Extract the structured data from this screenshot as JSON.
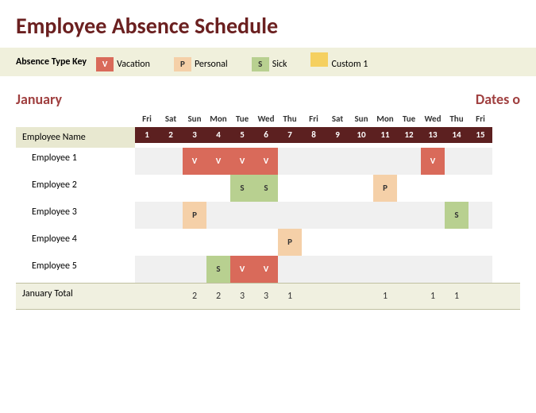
{
  "title": "Employee Absence Schedule",
  "legend": {
    "label": "Absence Type Key",
    "items": [
      {
        "code": "V",
        "text": "Vacation",
        "cls": "v-cell"
      },
      {
        "code": "P",
        "text": "Personal",
        "cls": "p-cell"
      },
      {
        "code": "S",
        "text": "Sick",
        "cls": "s-cell"
      },
      {
        "code": "",
        "text": "Custom 1",
        "cls": "c1-cell"
      }
    ]
  },
  "month": "January",
  "dates_label": "Dates o",
  "day_names": [
    "Fri",
    "Sat",
    "Sun",
    "Mon",
    "Tue",
    "Wed",
    "Thu",
    "Fri",
    "Sat",
    "Sun",
    "Mon",
    "Tue",
    "Wed",
    "Thu",
    "Fri"
  ],
  "dates": [
    "1",
    "2",
    "3",
    "4",
    "5",
    "6",
    "7",
    "8",
    "9",
    "10",
    "11",
    "12",
    "13",
    "14",
    "15"
  ],
  "emp_header": "Employee Name",
  "employees": [
    {
      "name": "Employee 1",
      "abs": [
        "",
        "",
        "V",
        "V",
        "V",
        "V",
        "",
        "",
        "",
        "",
        "",
        "",
        "V",
        "",
        ""
      ]
    },
    {
      "name": "Employee 2",
      "abs": [
        "",
        "",
        "",
        "",
        "S",
        "S",
        "",
        "",
        "",
        "",
        "P",
        "",
        "",
        "",
        ""
      ]
    },
    {
      "name": "Employee 3",
      "abs": [
        "",
        "",
        "P",
        "",
        "",
        "",
        "",
        "",
        "",
        "",
        "",
        "",
        "",
        "S",
        ""
      ]
    },
    {
      "name": "Employee 4",
      "abs": [
        "",
        "",
        "",
        "",
        "",
        "",
        "P",
        "",
        "",
        "",
        "",
        "",
        "",
        "",
        ""
      ]
    },
    {
      "name": "Employee 5",
      "abs": [
        "",
        "",
        "",
        "S",
        "V",
        "V",
        "",
        "",
        "",
        "",
        "",
        "",
        "",
        "",
        ""
      ]
    }
  ],
  "total_label": "January Total",
  "totals": [
    "",
    "",
    "2",
    "2",
    "3",
    "3",
    "1",
    "",
    "",
    "",
    "1",
    "",
    "1",
    "1",
    ""
  ],
  "weekend_idx": [
    1,
    2,
    8,
    9
  ]
}
